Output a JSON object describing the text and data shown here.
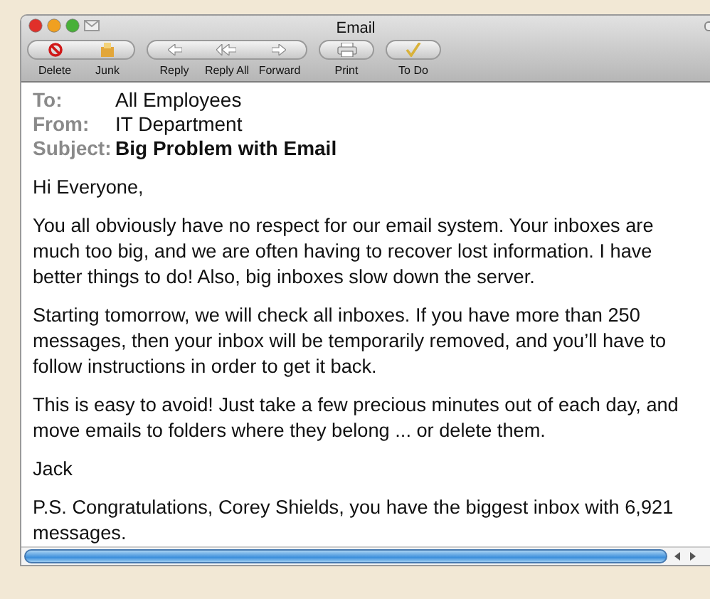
{
  "window": {
    "title": "Email"
  },
  "toolbar": [
    [
      {
        "label": "Delete",
        "kind": "delete"
      },
      {
        "label": "Junk",
        "kind": "junk"
      }
    ],
    [
      {
        "label": "Reply",
        "kind": "reply"
      },
      {
        "label": "Reply All",
        "kind": "reply-all"
      },
      {
        "label": "Forward",
        "kind": "forward"
      }
    ],
    [
      {
        "label": "Print",
        "kind": "print"
      }
    ],
    [
      {
        "label": "To Do",
        "kind": "todo"
      }
    ]
  ],
  "header": [
    {
      "label": "To:",
      "value": "All Employees",
      "bold": false
    },
    {
      "label": "From:",
      "value": "IT Department",
      "bold": false
    },
    {
      "label": "Subject:",
      "value": "Big Problem with Email",
      "bold": true
    }
  ],
  "body": [
    "Hi Everyone,",
    "You all obviously have no respect for our email system. Your inboxes are much too big, and we are often having to recover lost information. I have better things to do! Also, big inboxes slow down the server.",
    "Starting tomorrow, we will check all inboxes. If you have more than 250 messages, then your inbox will be temporarily removed, and you’ll have to follow instructions in order to get it back.",
    "This is easy to avoid! Just take a few precious minutes out of each day, and move emails to folders where they belong ... or delete them.",
    "Jack",
    "P.S. Congratulations, Corey Shields, you have the biggest inbox with 6,921 messages."
  ]
}
